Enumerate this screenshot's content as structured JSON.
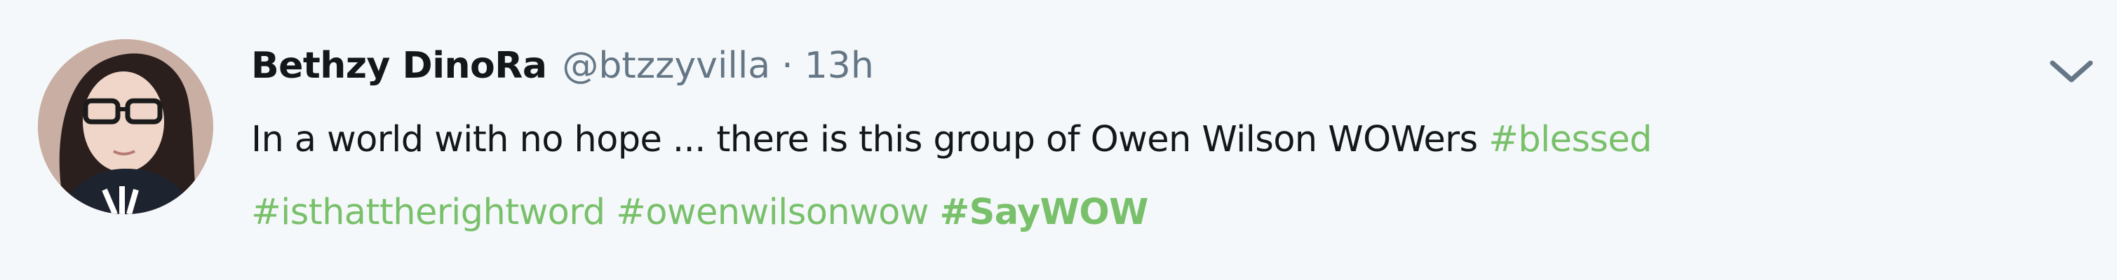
{
  "tweet": {
    "author": {
      "fullname": "Bethzy DinoRa",
      "username": "@btzzyvilla"
    },
    "separator": "·",
    "time": "13h",
    "text_main": "In a world with no hope ... there is this group of Owen Wilson WOWers ",
    "hashtags": [
      "#blessed",
      "#isthattherightword",
      "#owenwilsonwow",
      "#SayWOW"
    ],
    "caret_icon": "chevron-down-icon",
    "avatar_icon": "profile-photo",
    "colors": {
      "background": "#f5f8fa",
      "text": "#14171a",
      "muted": "#657786",
      "hashtag": "#79c06b"
    }
  }
}
